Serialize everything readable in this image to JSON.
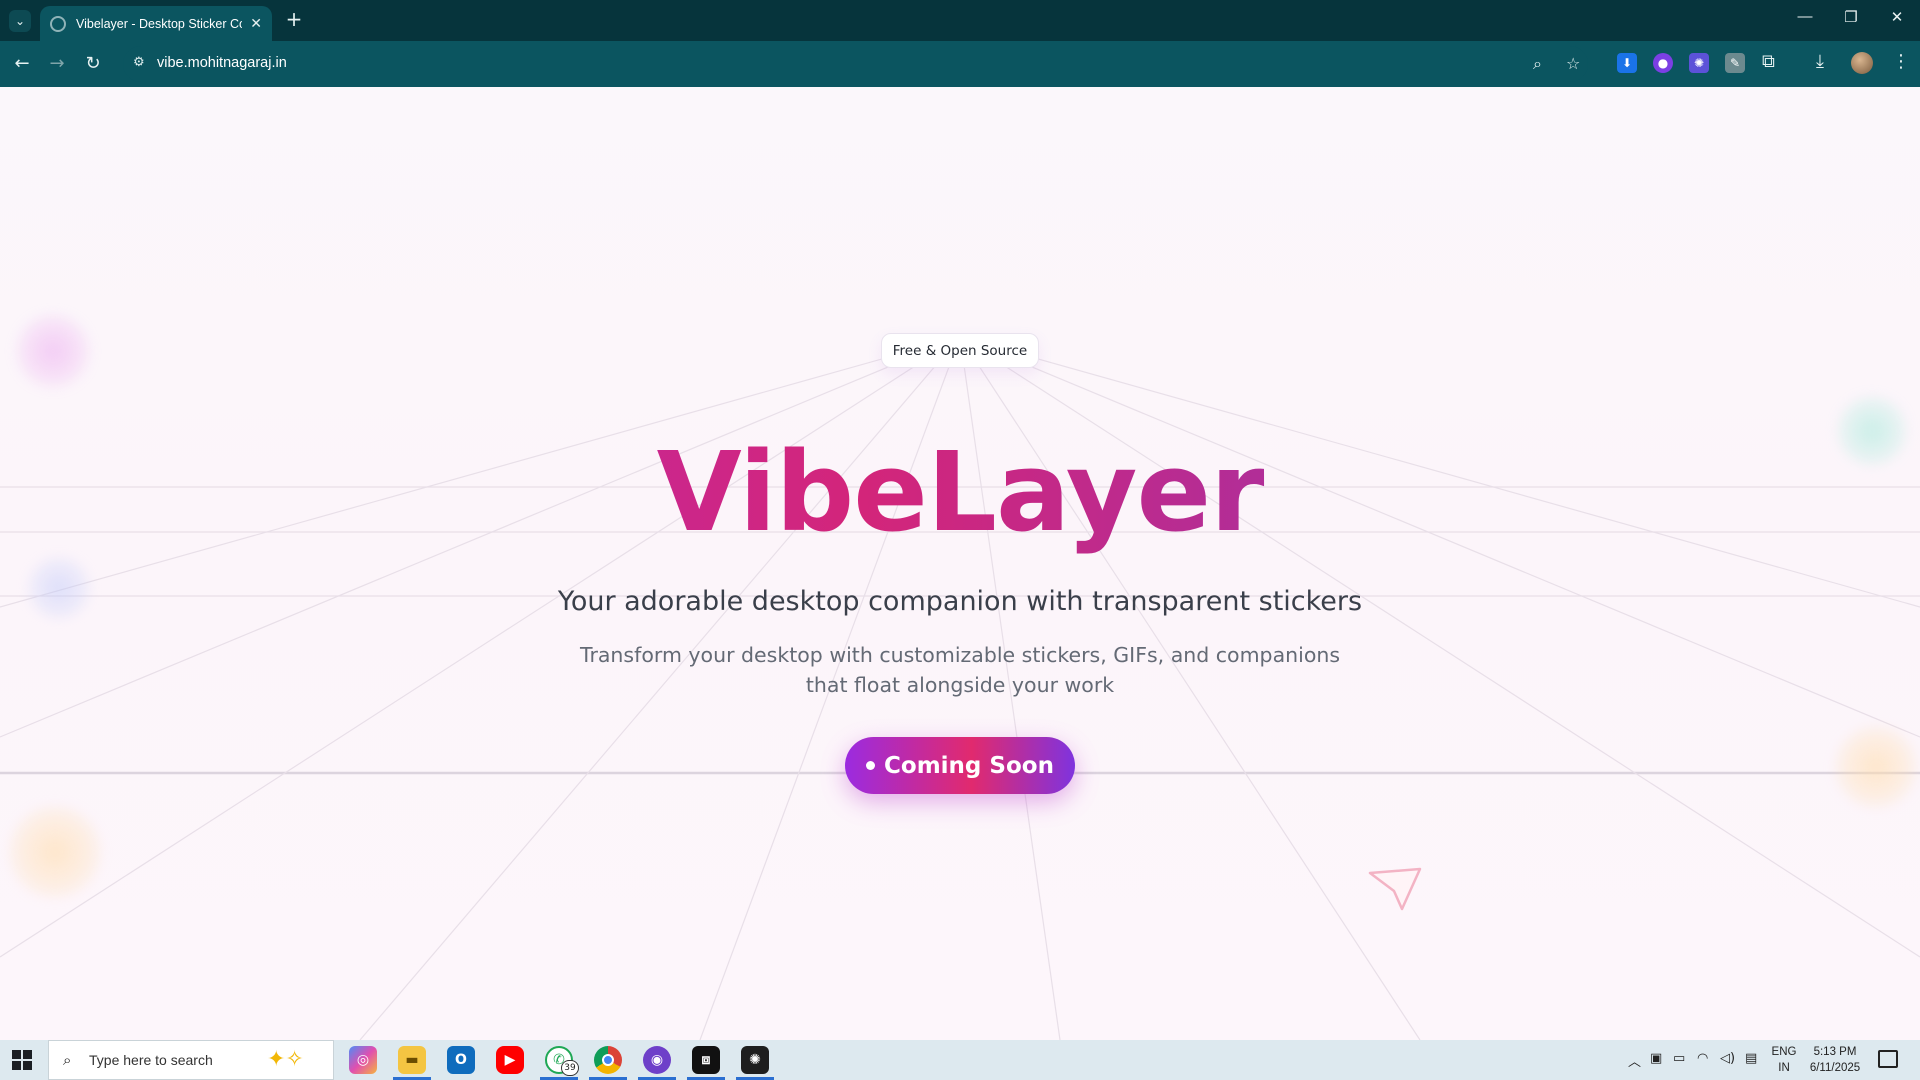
{
  "browser": {
    "tab_title": "Vibelayer - Desktop Sticker Com",
    "url": "vibe.mohitnagaraj.in",
    "new_tab": "+",
    "tab_close": "✕",
    "window": {
      "minimize": "—",
      "restore": "❐",
      "close": "✕"
    }
  },
  "page": {
    "badge": "Free & Open Source",
    "title": "VibeLayer",
    "subtitle": "Your adorable desktop companion with transparent stickers",
    "description_line1": "Transform your desktop with customizable stickers, GIFs, and companions",
    "description_line2": "that float alongside your work",
    "cta_label": "Coming Soon",
    "colors": {
      "gradient_start": "#b12cc2",
      "gradient_mid": "#d3257a",
      "gradient_end": "#7a3bc8"
    }
  },
  "taskbar": {
    "search_placeholder": "Type here to search",
    "whatsapp_badge": "39",
    "language_line1": "ENG",
    "language_line2": "IN",
    "time": "5:13 PM",
    "date": "6/11/2025",
    "apps": [
      "copilot",
      "file-explorer",
      "outlook",
      "youtube",
      "whatsapp",
      "chrome",
      "github",
      "capcut",
      "chatgpt"
    ]
  }
}
